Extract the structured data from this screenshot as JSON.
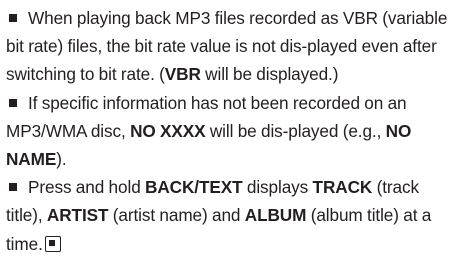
{
  "items": [
    {
      "t1": "When playing back MP3 files recorded as VBR (variable bit rate) files, the bit rate value is not dis-played even after switching to bit rate. (",
      "b1": "VBR",
      "t2": " will be displayed.)"
    },
    {
      "t1": "If specific information has not been recorded on an MP3/WMA disc, ",
      "b1": "NO XXXX",
      "t2": " will be dis-played (e.g., ",
      "b2": "NO NAME",
      "t3": ")."
    },
    {
      "t1": "Press and hold ",
      "b1": "BACK/TEXT",
      "t2": " displays ",
      "b2": "TRACK",
      "t3": " (track title), ",
      "b3": "ARTIST",
      "t4": " (artist name) and ",
      "b4": "ALBUM",
      "t5": " (album title)  at a time."
    }
  ]
}
